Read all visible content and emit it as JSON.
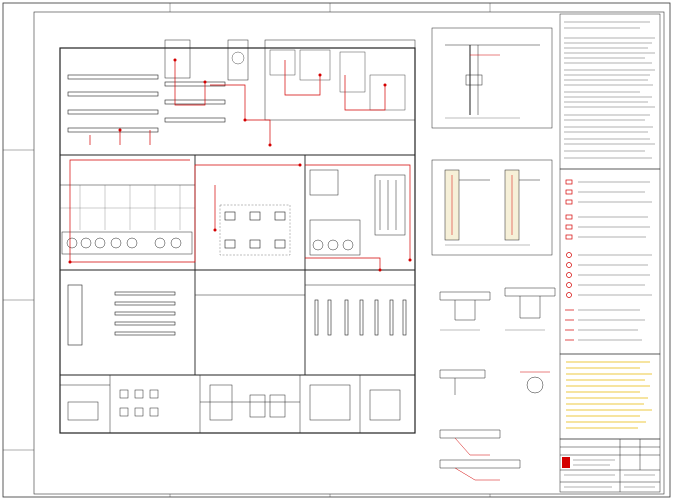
{
  "sheet": {
    "line_color": "#222222",
    "accent_color": "#d40000",
    "highlight_color": "#e6b800",
    "paper_color": "#ffffff"
  },
  "notes": {
    "header": "",
    "legend_title": ""
  },
  "title_block": {
    "company": "",
    "drawing": ""
  }
}
